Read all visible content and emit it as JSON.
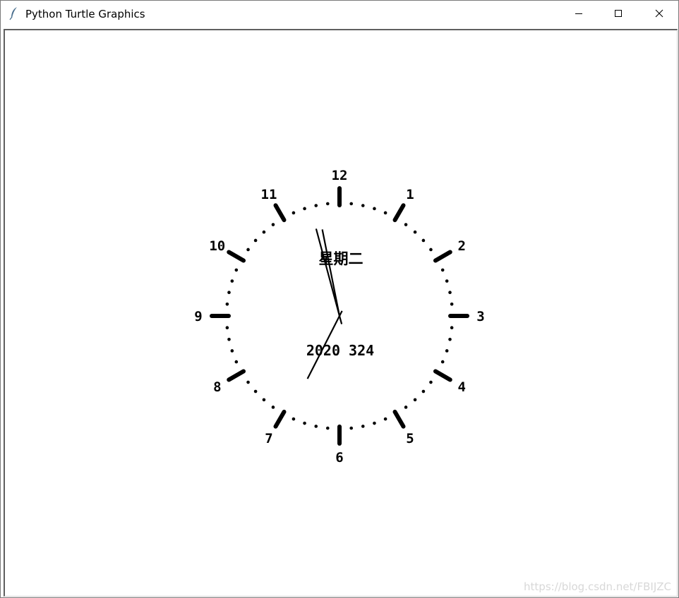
{
  "window": {
    "title": "Python Turtle Graphics",
    "icon": "feather-icon",
    "controls": [
      "minimize-icon",
      "maximize-icon",
      "close-icon"
    ]
  },
  "clock": {
    "hour_labels": [
      "12",
      "1",
      "2",
      "3",
      "4",
      "5",
      "6",
      "7",
      "8",
      "9",
      "10",
      "11"
    ],
    "weekday": "星期二",
    "date": "2020 324",
    "hands": {
      "hour_minutes": 697.5,
      "minute": 57.5,
      "second": 34.5
    },
    "ink_color": "#000000"
  },
  "watermark": "https://blog.csdn.net/FBIJZC"
}
